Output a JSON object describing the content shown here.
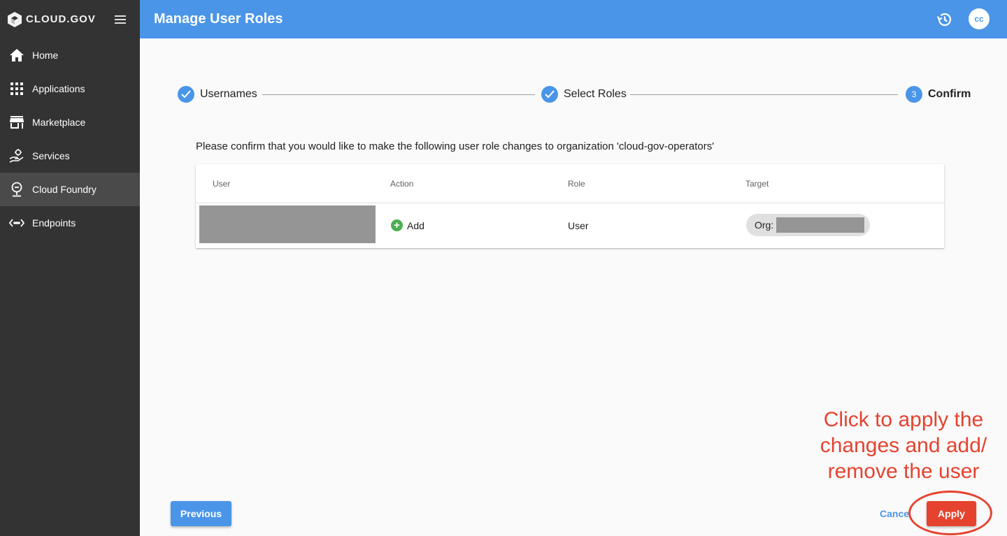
{
  "brand": {
    "name": "CLOUD.GOV"
  },
  "sidebar": {
    "items": [
      {
        "label": "Home",
        "icon": "home-icon"
      },
      {
        "label": "Applications",
        "icon": "apps-grid-icon"
      },
      {
        "label": "Marketplace",
        "icon": "store-icon"
      },
      {
        "label": "Services",
        "icon": "services-icon"
      },
      {
        "label": "Cloud Foundry",
        "icon": "cloud-foundry-icon",
        "active": true
      },
      {
        "label": "Endpoints",
        "icon": "endpoints-icon"
      }
    ]
  },
  "header": {
    "title": "Manage User Roles",
    "avatar_initials": "cc"
  },
  "stepper": {
    "steps": [
      {
        "label": "Usernames",
        "state": "complete"
      },
      {
        "label": "Select Roles",
        "state": "complete"
      },
      {
        "label": "Confirm",
        "state": "current",
        "number": "3"
      }
    ]
  },
  "confirm": {
    "message": "Please confirm that you would like to make the following user role changes to organization 'cloud-gov-operators'"
  },
  "table": {
    "columns": [
      "User",
      "Action",
      "Role",
      "Target"
    ],
    "rows": [
      {
        "action": "Add",
        "role": "User",
        "target_prefix": "Org:"
      }
    ]
  },
  "annotation": {
    "text": "Click to apply the changes and add/ remove the user",
    "color": "#e5432f"
  },
  "footer": {
    "previous_label": "Previous",
    "cancel_label": "Cancel",
    "apply_label": "Apply"
  },
  "colors": {
    "primary": "#4a95e8",
    "sidebar": "#333333",
    "danger": "#e5432f",
    "success": "#4caf50"
  }
}
